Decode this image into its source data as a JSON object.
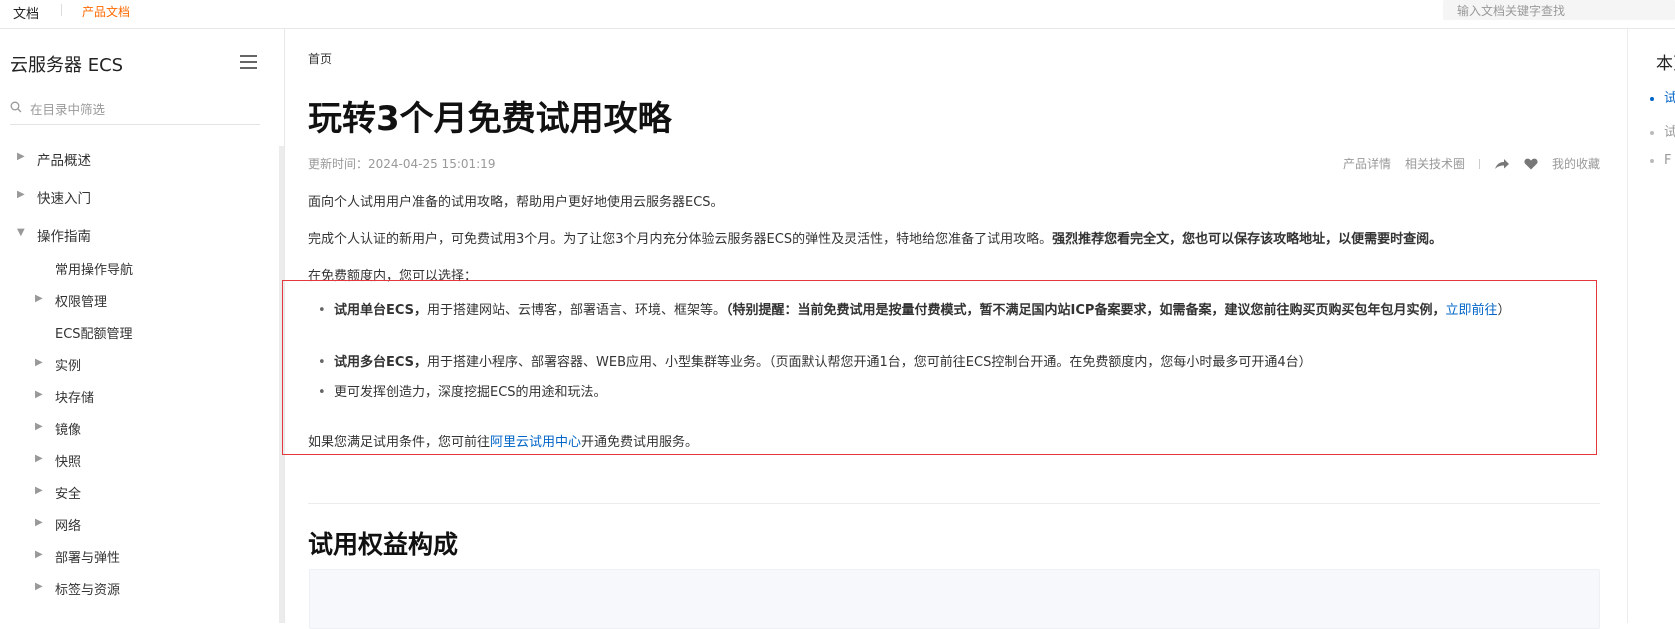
{
  "topbar": {
    "brand": "文档",
    "product": "产品文档",
    "search_placeholder": "输入文档关键字查找"
  },
  "sidebar": {
    "title": "云服务器 ECS",
    "filter_placeholder": "在目录中筛选",
    "items": [
      {
        "label": "产品概述",
        "level": 1,
        "expanded": false
      },
      {
        "label": "快速入门",
        "level": 1,
        "expanded": false
      },
      {
        "label": "操作指南",
        "level": 1,
        "expanded": true
      },
      {
        "label": "常用操作导航",
        "level": 2,
        "expandable": false
      },
      {
        "label": "权限管理",
        "level": 2,
        "expandable": true
      },
      {
        "label": "ECS配额管理",
        "level": 2,
        "expandable": false
      },
      {
        "label": "实例",
        "level": 2,
        "expandable": true
      },
      {
        "label": "块存储",
        "level": 2,
        "expandable": true
      },
      {
        "label": "镜像",
        "level": 2,
        "expandable": true
      },
      {
        "label": "快照",
        "level": 2,
        "expandable": true
      },
      {
        "label": "安全",
        "level": 2,
        "expandable": true
      },
      {
        "label": "网络",
        "level": 2,
        "expandable": true
      },
      {
        "label": "部署与弹性",
        "level": 2,
        "expandable": true
      },
      {
        "label": "标签与资源",
        "level": 2,
        "expandable": true
      }
    ]
  },
  "main": {
    "breadcrumb": "首页",
    "title": "玩转3个月免费试用攻略",
    "updated": "更新时间：2024-04-25 15:01:19",
    "actions": {
      "product_detail": "产品详情",
      "related_circle": "相关技术圈",
      "favorites": "我的收藏"
    },
    "intro": "面向个人试用用户准备的试用攻略，帮助用户更好地使用云服务器ECS。",
    "para2_plain": "完成个人认证的新用户，可免费试用3个月。为了让您3个月内充分体验云服务器ECS的弹性及灵活性，特地给您准备了试用攻略。",
    "para2_bold": "强烈推荐您看完全文，您也可以保存该攻略地址，以便需要时查阅。",
    "choose": "在免费额度内，您可以选择：",
    "bullets": {
      "b1_bold": "试用单台ECS，",
      "b1_text": "用于搭建网站、云博客，部署语言、环境、框架等。",
      "b1_note": "（特别提醒：当前免费试用是按量付费模式，暂不满足国内站ICP备案要求，如需备案，建议您前往购买页购买包年包月实例，",
      "b1_link": "立即前往",
      "b1_end": "）",
      "b2_bold": "试用多台ECS，",
      "b2_text": "用于搭建小程序、部署容器、WEB应用、小型集群等业务。（页面默认帮您开通1台，您可前往ECS控制台开通。在免费额度内，您每小时最多可开通4台）",
      "b3_text": "更可发挥创造力，深度挖掘ECS的用途和玩法。"
    },
    "trial_pre": "如果您满足试用条件，您可前往",
    "trial_link": "阿里云试用中心",
    "trial_post": "开通免费试用服务。",
    "section_title": "试用权益构成"
  },
  "toc": {
    "title": "本页",
    "items": [
      "试",
      "试",
      "F"
    ]
  },
  "colors": {
    "accent": "#ff6a00",
    "link": "#0064c8",
    "highlight_border": "#e4393c"
  }
}
